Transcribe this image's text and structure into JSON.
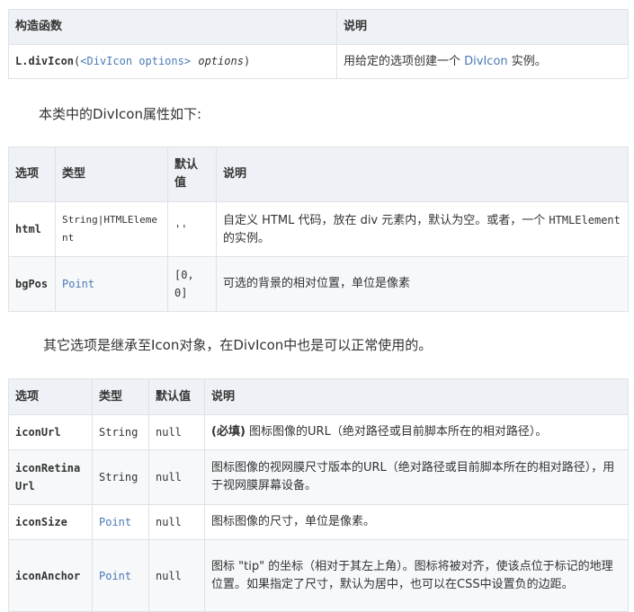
{
  "table1": {
    "headers": [
      "构造函数",
      "说明"
    ],
    "row": {
      "fn_name": "L.divIcon",
      "paren_open": "(",
      "type_link": "<DivIcon options>",
      "param": "options",
      "paren_close": ")",
      "desc_pre": "用给定的选项创建一个 ",
      "desc_link": "DivIcon",
      "desc_post": " 实例。"
    }
  },
  "intro1": "本类中的DivIcon属性如下:",
  "table2": {
    "headers": [
      "选项",
      "类型",
      "默认\n值",
      "说明"
    ],
    "rows": [
      {
        "option": "html",
        "type": "String|HTMLElement",
        "default": "''",
        "desc_pre": "自定义 HTML 代码，放在 div 元素内，默认为空。或者，一个 ",
        "desc_code": "HTMLElement",
        "desc_post": " 的实例。"
      },
      {
        "option": "bgPos",
        "type": "Point",
        "default": "[0, 0]",
        "desc": "可选的背景的相对位置，单位是像素"
      }
    ]
  },
  "intro2": "其它选项是继承至Icon对象，在DivIcon中也是可以正常使用的。",
  "table3": {
    "headers": [
      "选项",
      "类型",
      "默认值",
      "说明"
    ],
    "rows": [
      {
        "option": "iconUrl",
        "type": "String",
        "default": "null",
        "required": "(必填)",
        "desc": " 图标图像的URL（绝对路径或目前脚本所在的相对路径）。"
      },
      {
        "option": "iconRetinaUrl",
        "type": "String",
        "default": "null",
        "desc": "图标图像的视网膜尺寸版本的URL（绝对路径或目前脚本所在的相对路径），用于视网膜屏幕设备。"
      },
      {
        "option": "iconSize",
        "type": "Point",
        "default": "null",
        "desc": "图标图像的尺寸，单位是像素。"
      },
      {
        "option": "iconAnchor",
        "type": "Point",
        "default": "null",
        "desc": "图标 \"tip\" 的坐标（相对于其左上角）。图标将被对齐，使该点位于标记的地理位置。如果指定了尺寸，默认为居中，也可以在CSS中设置负的边距。"
      }
    ]
  },
  "colors": {
    "link": "#4a7ab5",
    "header_bg": "#eef1f5",
    "border": "#dfe2e5"
  }
}
